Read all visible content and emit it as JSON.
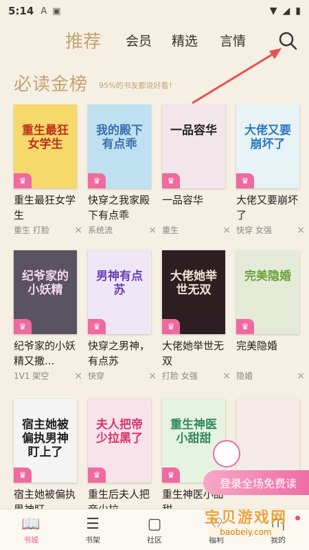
{
  "status_bar": {
    "time": "5:14",
    "icons": [
      "a-icon",
      "notification-icon"
    ],
    "right_icons": [
      "wifi-icon",
      "signal-icon",
      "battery-icon"
    ]
  },
  "nav": {
    "active_tab": "推荐",
    "tabs": [
      "会员",
      "精选",
      "言情"
    ]
  },
  "section": {
    "title": "必读金榜",
    "subtitle": "95%的书友都说好看！"
  },
  "books": [
    {
      "cover_text": "重生最狂女学生",
      "title": "重生最狂女学生",
      "tags": "重生  打脸",
      "cover_color": "#f5d96a",
      "text_color": "#c03020"
    },
    {
      "cover_text": "我的殿下有点乖",
      "title": "快穿之我家殿下有点乖",
      "tags": "系统流",
      "cover_color": "#bfe0f0",
      "text_color": "#3a6fb0"
    },
    {
      "cover_text": "一品容华",
      "title": "一品容华",
      "tags": "重生",
      "cover_color": "#f3e6ea",
      "text_color": "#222222"
    },
    {
      "cover_text": "大佬又要崩坏了",
      "title": "大佬又要崩坏了",
      "tags": "快穿  女强",
      "cover_color": "#e8f3f6",
      "text_color": "#2b7bbf"
    },
    {
      "cover_text": "纪爷家的小妖精",
      "title": "纪爷家的小妖精又撒...",
      "tags": "1V1  架空",
      "cover_color": "#5a5360",
      "text_color": "#f2d7e8"
    },
    {
      "cover_text": "男神有点苏",
      "title": "快穿之男神，有点苏",
      "tags": "快穿",
      "cover_color": "#efe7f6",
      "text_color": "#6a3fb8"
    },
    {
      "cover_text": "大佬她举世无双",
      "title": "大佬她举世无双",
      "tags": "打脸  女强",
      "cover_color": "#2d1e22",
      "text_color": "#f4e6d8"
    },
    {
      "cover_text": "完美隐婚",
      "title": "完美隐婚",
      "tags": "隐婚",
      "cover_color": "#e4ecd8",
      "text_color": "#6aa23a"
    },
    {
      "cover_text": "宿主她被偏执男神盯上了",
      "title": "宿主她被偏执男神盯...",
      "tags": "",
      "cover_color": "#f4f4f4",
      "text_color": "#222222"
    },
    {
      "cover_text": "夫人把帝少拉黑了",
      "title": "重生后夫人把帝少拉...",
      "tags": "",
      "cover_color": "#f9e3ea",
      "text_color": "#d8336a"
    },
    {
      "cover_text": "重生神医小甜甜",
      "title": "重生神医小甜甜...",
      "tags": "",
      "cover_color": "#e6f2e2",
      "text_color": "#2f8a5a"
    },
    {
      "cover_text": "",
      "title": "",
      "tags": "",
      "cover_color": "#f5ece8",
      "text_color": "#444444"
    }
  ],
  "promo": {
    "label": "登录全场免费读"
  },
  "watermark": {
    "title": "宝贝游戏网",
    "url": "baobeiy.com"
  },
  "bottom_nav": [
    {
      "label": "书城",
      "icon": "bookstore-icon"
    },
    {
      "label": "书架",
      "icon": "bookshelf-icon"
    },
    {
      "label": "社区",
      "icon": "community-icon"
    },
    {
      "label": "福利",
      "icon": "welfare-icon"
    },
    {
      "label": "我的",
      "icon": "profile-icon"
    }
  ],
  "colors": {
    "accent_gold": "#c4a372",
    "accent_pink": "#ef5c92",
    "background": "#f6efe3"
  }
}
